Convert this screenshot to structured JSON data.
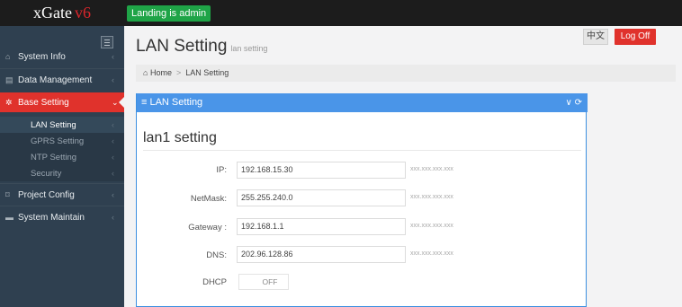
{
  "app": {
    "logo_text": "xGate",
    "logo_version": "v6",
    "landing_badge": "Landing is admin"
  },
  "header": {
    "title": "LAN Setting",
    "subtitle": "lan setting",
    "lang_button": "中文",
    "logoff_button": "Log Off"
  },
  "breadcrumb": {
    "home": "Home",
    "separator": ">",
    "current": "LAN Setting"
  },
  "sidebar": {
    "items": [
      {
        "label": "System Info",
        "icon": "home-icon"
      },
      {
        "label": "Data Management",
        "icon": "chart-icon"
      },
      {
        "label": "Base Setting",
        "icon": "gears-icon",
        "active": true
      },
      {
        "label": "Project Config",
        "icon": "bookmark-icon"
      },
      {
        "label": "System Maintain",
        "icon": "briefcase-icon"
      }
    ],
    "subitems": [
      {
        "label": "LAN Setting",
        "selected": true
      },
      {
        "label": "GPRS Setting"
      },
      {
        "label": "NTP Setting"
      },
      {
        "label": "Security"
      }
    ],
    "chevron": "‹"
  },
  "panel": {
    "title": "≡ LAN Setting",
    "tools": "∨ ⟳",
    "section_title": "lan1 setting",
    "fields": [
      {
        "label": "IP:",
        "value": "192.168.15.30",
        "hint": "xxx.xxx.xxx.xxx"
      },
      {
        "label": "NetMask:",
        "value": "255.255.240.0",
        "hint": "xxx.xxx.xxx.xxx"
      },
      {
        "label": "Gateway :",
        "value": "192.168.1.1",
        "hint": "xxx.xxx.xxx.xxx"
      },
      {
        "label": "DNS:",
        "value": "202.96.128.86",
        "hint": "xxx.xxx.xxx.xxx"
      }
    ],
    "dhcp": {
      "label": "DHCP",
      "value": "OFF"
    }
  },
  "colors": {
    "accent_red": "#e0322c",
    "sidebar_bg": "#2f4050",
    "panel_blue": "#4a95e8",
    "badge_green": "#1fa447"
  }
}
